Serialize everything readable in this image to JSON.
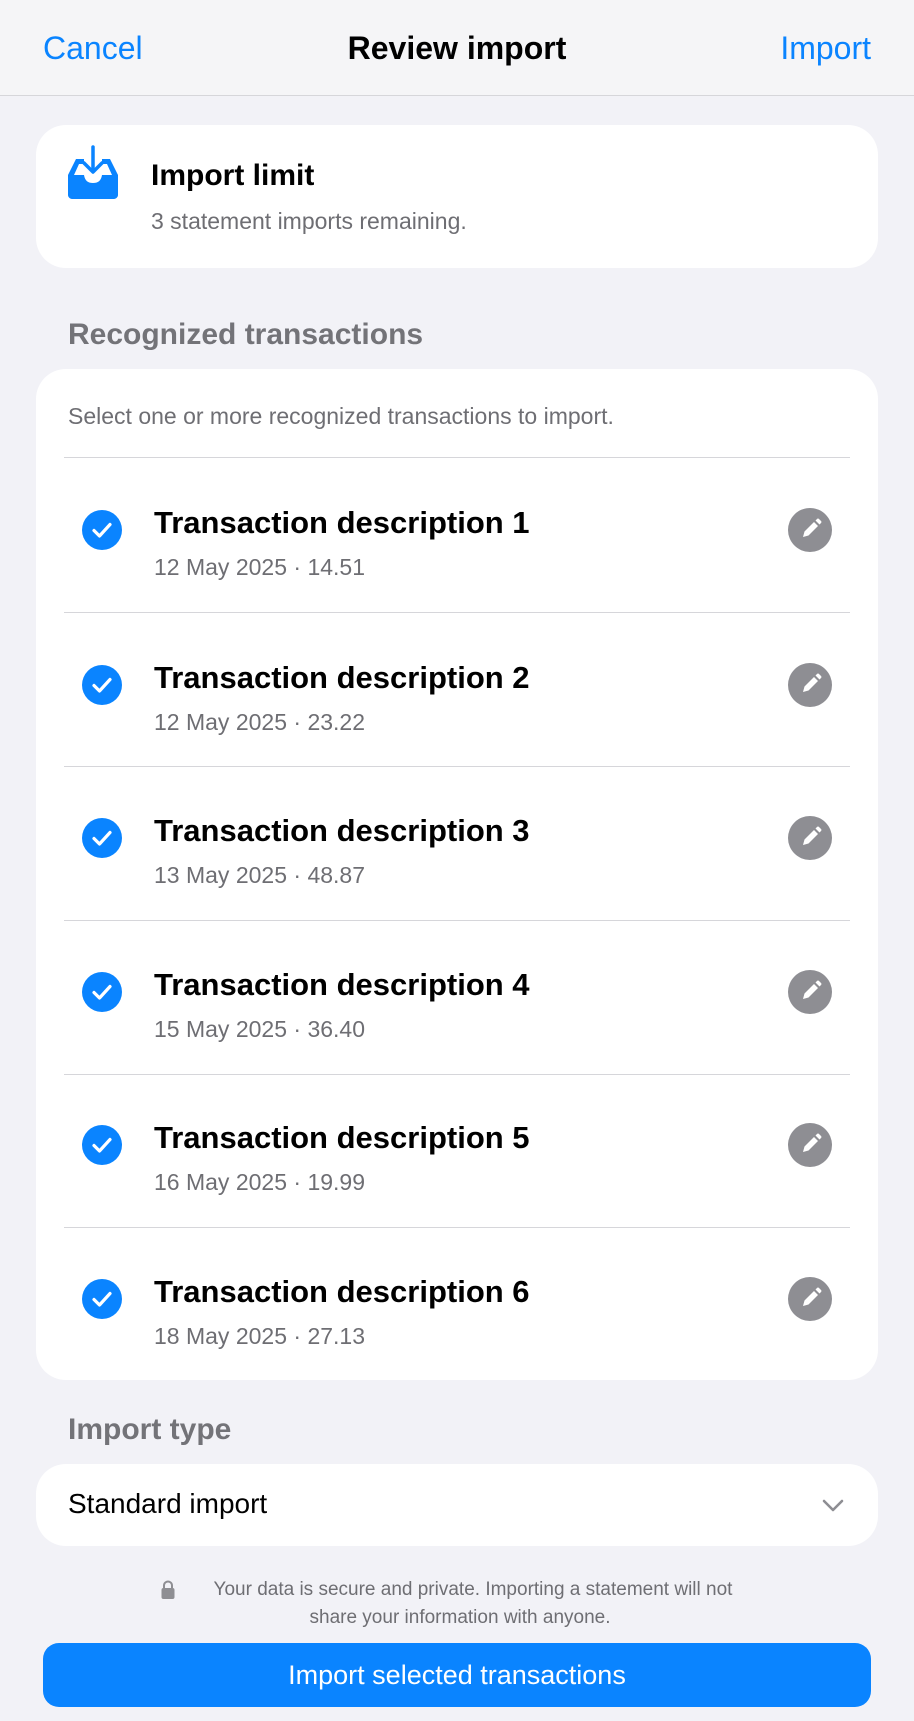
{
  "nav": {
    "cancel_label": "Cancel",
    "title": "Review import",
    "import_label": "Import"
  },
  "import_limit": {
    "icon": "tray-download-icon",
    "title": "Import limit",
    "subtitle": "3 statement imports remaining."
  },
  "recognized": {
    "header": "Recognized transactions",
    "hint": "Select one or more recognized transactions to import.",
    "transactions": [
      {
        "description": "Transaction description 1",
        "date": "12 May 2025",
        "separator": "·",
        "amount": "14.51",
        "selected": true
      },
      {
        "description": "Transaction description 2",
        "date": "12 May 2025",
        "separator": "·",
        "amount": "23.22",
        "selected": true
      },
      {
        "description": "Transaction description 3",
        "date": "13 May 2025",
        "separator": "·",
        "amount": "48.87",
        "selected": true
      },
      {
        "description": "Transaction description 4",
        "date": "15 May 2025",
        "separator": "·",
        "amount": "36.40",
        "selected": true
      },
      {
        "description": "Transaction description 5",
        "date": "16 May 2025",
        "separator": "·",
        "amount": "19.99",
        "selected": true
      },
      {
        "description": "Transaction description 6",
        "date": "18 May 2025",
        "separator": "·",
        "amount": "27.13",
        "selected": true
      }
    ]
  },
  "import_type": {
    "header": "Import type",
    "selected": "Standard import"
  },
  "privacy": {
    "icon": "lock-icon",
    "text_line1": "Your data is secure and private. Importing a statement will not",
    "text_line2": "share your information with anyone."
  },
  "primary_button": {
    "label": "Import selected transactions"
  },
  "colors": {
    "accent": "#0a84ff",
    "background": "#f2f2f7",
    "secondary_text": "#6e6e73",
    "edit_icon_bg": "#8e8e93"
  }
}
